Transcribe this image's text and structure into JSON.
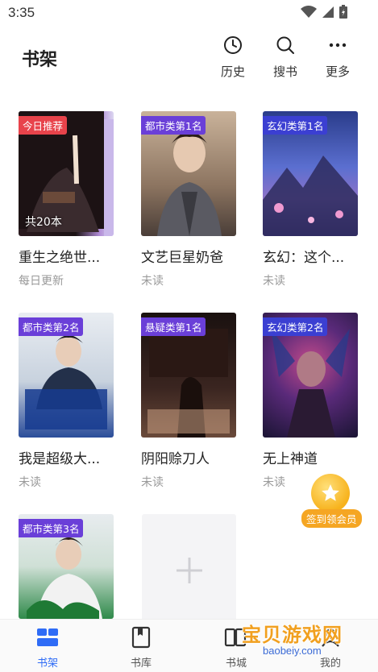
{
  "status_bar": {
    "time": "3:35"
  },
  "header": {
    "title": "书架",
    "actions": [
      {
        "label": "历史",
        "icon": "clock-icon"
      },
      {
        "label": "搜书",
        "icon": "search-icon"
      },
      {
        "label": "更多",
        "icon": "more-icon"
      }
    ]
  },
  "books": [
    {
      "badge": "今日推荐",
      "badge_color": "#e8434b",
      "count": "共20本",
      "title": "重生之绝世...",
      "status": "每日更新"
    },
    {
      "badge": "都市类第1名",
      "badge_color": "#6a3fd8",
      "title": "文艺巨星奶爸",
      "status": "未读"
    },
    {
      "badge": "玄幻类第1名",
      "badge_color": "#3b3fd2",
      "title": "玄幻：这个...",
      "status": "未读"
    },
    {
      "badge": "都市类第2名",
      "badge_color": "#6a3fd8",
      "title": "我是超级大...",
      "status": "未读"
    },
    {
      "badge": "悬疑类第1名",
      "badge_color": "#6a3fd8",
      "title": "阴阳赊刀人",
      "status": "未读"
    },
    {
      "badge": "玄幻类第2名",
      "badge_color": "#3b3fd2",
      "title": "无上神道",
      "status": "未读"
    },
    {
      "badge": "都市类第3名",
      "badge_color": "#6a3fd8",
      "title": "",
      "status": ""
    }
  ],
  "reward": {
    "label": "签到领会员"
  },
  "bottom_nav": [
    {
      "label": "书架",
      "icon": "bookshelf-icon",
      "active": true
    },
    {
      "label": "书库",
      "icon": "book-library-icon",
      "active": false
    },
    {
      "label": "书城",
      "icon": "book-city-icon",
      "active": false
    },
    {
      "label": "我的",
      "icon": "profile-icon",
      "active": false
    }
  ],
  "watermark": {
    "text": "宝贝游戏网",
    "url": "baobeiy.com"
  },
  "colors": {
    "accent": "#2f6cf6"
  }
}
